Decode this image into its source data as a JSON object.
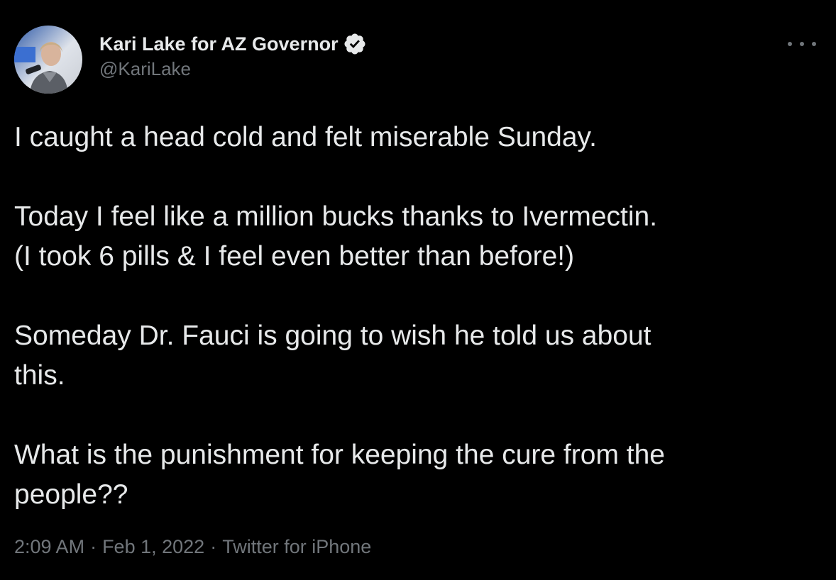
{
  "author": {
    "display_name": "Kari Lake for AZ Governor",
    "handle": "@KariLake",
    "verified": true,
    "avatar_icon": "profile-photo",
    "verified_icon": "verified-badge-icon"
  },
  "menu": {
    "icon": "more-options-icon"
  },
  "tweet": {
    "lines": [
      "I caught a head cold and felt miserable Sunday.",
      "",
      "Today I feel like a million bucks thanks to Ivermectin.",
      "(I took 6 pills & I feel even better than before!)",
      "",
      "Someday Dr. Fauci is going to wish he told us about",
      "this.",
      "",
      "What is the punishment for keeping the cure from the",
      "people??"
    ]
  },
  "meta": {
    "time": "2:09 AM",
    "separator": "·",
    "date": "Feb 1, 2022",
    "source": "Twitter for iPhone"
  },
  "colors": {
    "background": "#000000",
    "text_primary": "#e7e9ea",
    "text_secondary": "#71767b",
    "verified_badge": "#e7e9ea"
  }
}
